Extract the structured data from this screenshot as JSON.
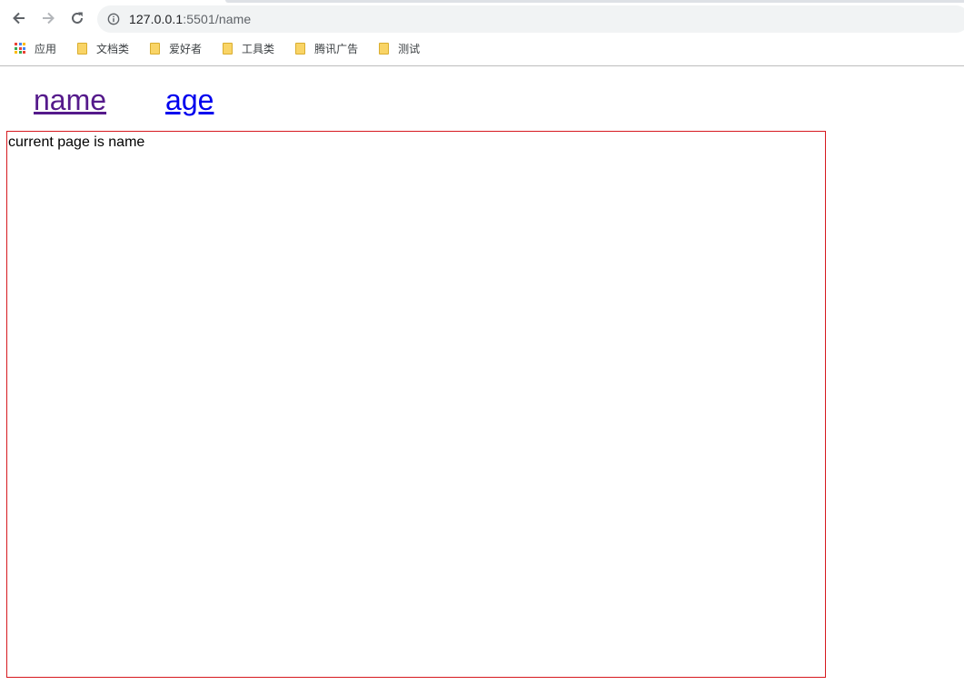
{
  "browser": {
    "url_host": "127.0.0.1",
    "url_rest": ":5501/name",
    "icons": {
      "back": "arrow-left-icon",
      "forward": "arrow-right-icon",
      "reload": "reload-icon",
      "info": "info-icon"
    }
  },
  "bookmarks": [
    {
      "label": "应用",
      "icon": "apps-grid-icon"
    },
    {
      "label": "文档类",
      "icon": "folder-icon"
    },
    {
      "label": "爱好者",
      "icon": "folder-icon"
    },
    {
      "label": "工具类",
      "icon": "folder-icon"
    },
    {
      "label": "腾讯广告",
      "icon": "folder-icon"
    },
    {
      "label": "测试",
      "icon": "folder-icon"
    }
  ],
  "page": {
    "nav_links": [
      {
        "label": "name",
        "state": "visited"
      },
      {
        "label": "age",
        "state": "unvisited"
      }
    ],
    "content_text": "current page is name"
  },
  "colors": {
    "visited_link": "#551a8b",
    "unvisited_link": "#0000ee",
    "content_border": "#d6191f"
  }
}
